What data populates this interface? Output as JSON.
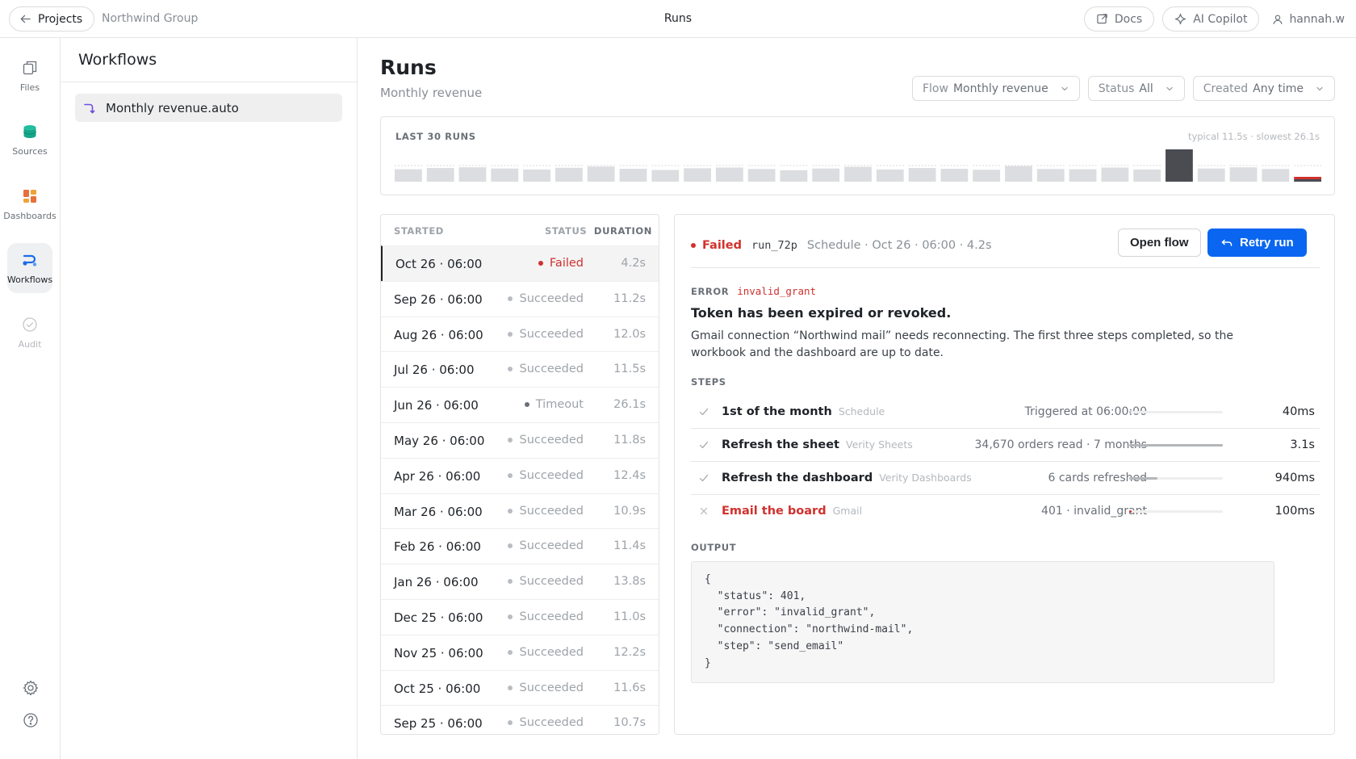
{
  "topbar": {
    "back_label": "Projects",
    "breadcrumb": "Northwind Group",
    "title": "Runs",
    "docs_label": "Docs",
    "copilot_label": "AI Copilot",
    "user_label": "hannah.w"
  },
  "rail": {
    "items": [
      {
        "label": "Files",
        "icon": "files-icon"
      },
      {
        "label": "Sources",
        "icon": "database-icon"
      },
      {
        "label": "Dashboards",
        "icon": "dashboard-icon"
      },
      {
        "label": "Workflows",
        "icon": "workflow-icon"
      },
      {
        "label": "Audit",
        "icon": "check-circle-icon"
      }
    ],
    "bottom_icons": [
      "gear-icon",
      "help-icon"
    ]
  },
  "workflows": {
    "title": "Workflows",
    "items": [
      {
        "label": "Monthly revenue.auto"
      }
    ]
  },
  "main": {
    "title": "Runs",
    "subtitle": "Monthly revenue",
    "filters": [
      {
        "key": "Flow",
        "value": "Monthly revenue"
      },
      {
        "key": "Status",
        "value": "All"
      },
      {
        "key": "Created",
        "value": "Any time"
      }
    ]
  },
  "chart": {
    "label": "LAST 30 RUNS",
    "meta": "typical 11.5s · slowest 26.1s",
    "colors": {
      "normal": "#dcdde0",
      "slowest": "#4a4c52",
      "failed": "#d0312d"
    }
  },
  "chart_data": {
    "type": "bar",
    "title": "LAST 30 RUNS",
    "unit": "s",
    "values": [
      11.3,
      11.8,
      12.1,
      11.6,
      11.2,
      11.9,
      12.4,
      11.5,
      11.0,
      11.7,
      12.0,
      11.4,
      10.9,
      11.6,
      12.3,
      11.2,
      11.8,
      11.5,
      11.1,
      12.6,
      11.4,
      11.3,
      12.0,
      11.2,
      26.1,
      11.6,
      12.1,
      11.4,
      4.2
    ],
    "statuses": [
      "ok",
      "ok",
      "ok",
      "ok",
      "ok",
      "ok",
      "ok",
      "ok",
      "ok",
      "ok",
      "ok",
      "ok",
      "ok",
      "ok",
      "ok",
      "ok",
      "ok",
      "ok",
      "ok",
      "ok",
      "ok",
      "ok",
      "ok",
      "ok",
      "timeout",
      "ok",
      "ok",
      "ok",
      "failed"
    ],
    "ylim": [
      0,
      26.1
    ]
  },
  "runs": {
    "headers": {
      "started": "STARTED",
      "status": "STATUS",
      "duration": "DURATION"
    },
    "rows": [
      {
        "started": "Oct 26 · 06:00",
        "status": "Failed",
        "kind": "failed",
        "duration": "4.2s",
        "selected": true
      },
      {
        "started": "Sep 26 · 06:00",
        "status": "Succeeded",
        "kind": "ok",
        "duration": "11.2s"
      },
      {
        "started": "Aug 26 · 06:00",
        "status": "Succeeded",
        "kind": "ok",
        "duration": "12.0s"
      },
      {
        "started": "Jul 26 · 06:00",
        "status": "Succeeded",
        "kind": "ok",
        "duration": "11.5s"
      },
      {
        "started": "Jun 26 · 06:00",
        "status": "Timeout",
        "kind": "timeout",
        "duration": "26.1s"
      },
      {
        "started": "May 26 · 06:00",
        "status": "Succeeded",
        "kind": "ok",
        "duration": "11.8s"
      },
      {
        "started": "Apr 26 · 06:00",
        "status": "Succeeded",
        "kind": "ok",
        "duration": "12.4s"
      },
      {
        "started": "Mar 26 · 06:00",
        "status": "Succeeded",
        "kind": "ok",
        "duration": "10.9s"
      },
      {
        "started": "Feb 26 · 06:00",
        "status": "Succeeded",
        "kind": "ok",
        "duration": "11.4s"
      },
      {
        "started": "Jan 26 · 06:00",
        "status": "Succeeded",
        "kind": "ok",
        "duration": "13.8s"
      },
      {
        "started": "Dec 25 · 06:00",
        "status": "Succeeded",
        "kind": "ok",
        "duration": "11.0s"
      },
      {
        "started": "Nov 25 · 06:00",
        "status": "Succeeded",
        "kind": "ok",
        "duration": "12.2s"
      },
      {
        "started": "Oct 25 · 06:00",
        "status": "Succeeded",
        "kind": "ok",
        "duration": "11.6s"
      },
      {
        "started": "Sep 25 · 06:00",
        "status": "Succeeded",
        "kind": "ok",
        "duration": "10.7s"
      }
    ]
  },
  "detail": {
    "status": "Failed",
    "run_id": "run_72p",
    "meta": "Schedule · Oct 26 · 06:00 · 4.2s",
    "open_label": "Open flow",
    "retry_label": "Retry run",
    "error_label": "ERROR",
    "error_code": "invalid_grant",
    "error_title": "Token has been expired or revoked.",
    "error_body": "Gmail connection “Northwind mail” needs reconnecting. The first three steps completed, so the workbook and the dashboard are up to date.",
    "steps_label": "STEPS",
    "steps": [
      {
        "name": "1st of the month",
        "source": "Schedule",
        "info": "Triggered at 06:00:00",
        "duration": "40ms",
        "fraction": 0.01,
        "state": "done"
      },
      {
        "name": "Refresh the sheet",
        "source": "Verity Sheets",
        "info": "34,670 orders read · 7 months",
        "duration": "3.1s",
        "fraction": 1.0,
        "state": "done"
      },
      {
        "name": "Refresh the dashboard",
        "source": "Verity Dashboards",
        "info": "6 cards refreshed",
        "duration": "940ms",
        "fraction": 0.3,
        "state": "done"
      },
      {
        "name": "Email the board",
        "source": "Gmail",
        "info": "401 · invalid_grant",
        "duration": "100ms",
        "fraction": 0.03,
        "state": "failed"
      }
    ],
    "output_label": "OUTPUT",
    "output_text": "{\n  \"status\": 401,\n  \"error\": \"invalid_grant\",\n  \"connection\": \"northwind-mail\",\n  \"step\": \"send_email\"\n}"
  }
}
